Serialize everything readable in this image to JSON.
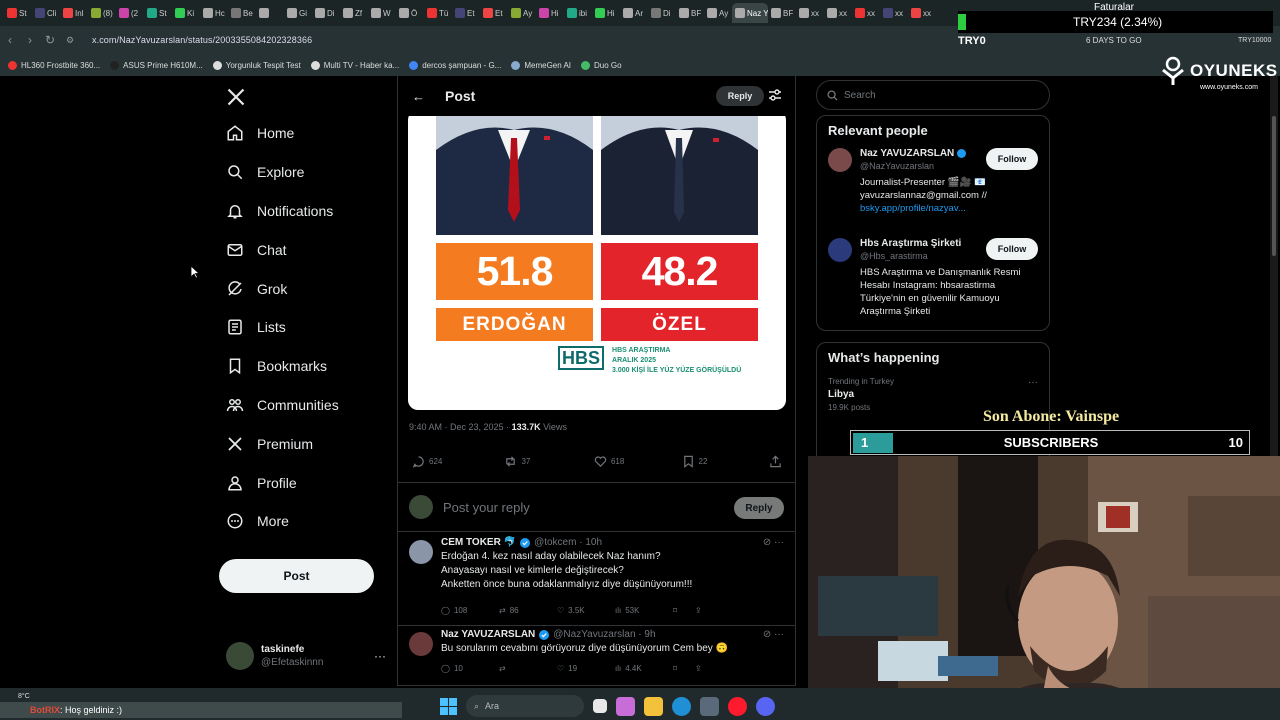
{
  "browser": {
    "tabs": [
      "St",
      "Cli",
      "Inl",
      "(8)",
      "(2",
      "St",
      "Ki",
      "Hc",
      "Be",
      "",
      "Gi",
      "Di",
      "Zf",
      "W",
      "Ö",
      "Tü",
      "Et",
      "Et",
      "Ay",
      "Hi",
      "ibi",
      "Hi",
      "Ar",
      "Di",
      "BF",
      "Ay",
      "Naz Y",
      "BF",
      "xx",
      "xx",
      "xx",
      "xx",
      "xx"
    ],
    "active_tab_index": 26,
    "url": "x.com/NazYavuzarslan/status/2003355084202328366",
    "bookmarks": [
      "HL360 Frostbite 360...",
      "ASUS Prime H610M...",
      "Yorgunluk Tespit Test",
      "Multi TV - Haber ka...",
      "dercos şampuan - G...",
      "MemeGen AI",
      "Duo Go"
    ],
    "ext_text": "6 DAYS TO GO",
    "ext_text2": "TRY10000"
  },
  "ticker": {
    "title": "Faturalar",
    "value": "TRY234 (2.34%)",
    "label": "TRY0"
  },
  "brand": {
    "name": "OYUNEKS",
    "site": "www.oyuneks.com"
  },
  "sidebar": {
    "items": [
      {
        "label": "Home",
        "icon": "home-icon"
      },
      {
        "label": "Explore",
        "icon": "search-icon"
      },
      {
        "label": "Notifications",
        "icon": "bell-icon"
      },
      {
        "label": "Chat",
        "icon": "mail-icon"
      },
      {
        "label": "Grok",
        "icon": "grok-icon"
      },
      {
        "label": "Lists",
        "icon": "list-icon"
      },
      {
        "label": "Bookmarks",
        "icon": "bookmark-icon"
      },
      {
        "label": "Communities",
        "icon": "communities-icon"
      },
      {
        "label": "Premium",
        "icon": "x-logo-icon"
      },
      {
        "label": "Profile",
        "icon": "person-icon"
      },
      {
        "label": "More",
        "icon": "more-circle-icon"
      }
    ],
    "post_label": "Post",
    "user": {
      "name": "taskinefe",
      "handle": "@Efetaskinnn"
    }
  },
  "post": {
    "header_title": "Post",
    "reply_label": "Reply",
    "image": {
      "left": {
        "pct": "51.8",
        "name": "ERDOĞAN",
        "color": "#f47b20"
      },
      "right": {
        "pct": "48.2",
        "name": "ÖZEL",
        "color": "#e3242b"
      },
      "logo": "HBS",
      "source_lines": [
        "HBS ARAŞTIRMA",
        "ARALIK 2025",
        "3.000 KİŞİ İLE YÜZ YÜZE GÖRÜŞÜLDÜ"
      ]
    },
    "time": "9:40 AM · Dec 23, 2025 · ",
    "views_count": "133.7K",
    "views_label": " Views",
    "stats": {
      "replies": "624",
      "reposts": "37",
      "likes": "618",
      "bookmarks": "22"
    },
    "composer_placeholder": "Post your reply",
    "composer_button": "Reply"
  },
  "replies": [
    {
      "name": "CEM TOKER 🐬",
      "handle": "@tokcem · 10h",
      "text": "Erdoğan 4. kez nasıl aday olabilecek Naz hanım?\nAnayasayı nasıl ve kimlerle değiştirecek?\nAnketten önce buna odaklanmalıyız diye düşünüyorum!!!",
      "replies": "108",
      "reposts": "86",
      "likes": "3.5K",
      "views": "53K"
    },
    {
      "name": "Naz YAVUZARSLAN",
      "handle": "@NazYavuzarslan · 9h",
      "text": "Bu sorularım cevabını görüyoruz diye düşünüyorum Cem bey 🙃",
      "replies": "10",
      "reposts": "",
      "likes": "19",
      "views": "4.4K"
    }
  ],
  "right": {
    "search_placeholder": "Search",
    "relevant_title": "Relevant people",
    "people": [
      {
        "name": "Naz YAVUZARSLAN",
        "handle": "@NazYavuzarslan",
        "bio": "Journalist-Presenter 🎬🎥 📧\nyavuzarslannaz@gmail.com //",
        "link": "bsky.app/profile/nazyav...",
        "follow": "Follow"
      },
      {
        "name": "Hbs Araştırma Şirketi",
        "handle": "@Hbs_arastirma",
        "bio": "HBS Araştırma ve Danışmanlık Resmi\nHesabı Instagram: hbsarastirma\nTürkiye'nin en güvenilir Kamuoyu\nAraştırma Şirketi",
        "link": "",
        "follow": "Follow"
      }
    ],
    "happening_title": "What’s happening",
    "trends": [
      {
        "kicker": "Trending in Turkey",
        "title": "Libya",
        "posts": "19.9K posts"
      }
    ]
  },
  "overlay": {
    "last_sub": "Son Abone: Vainspe",
    "sub_current": "1",
    "sub_label": "SUBSCRIBERS",
    "sub_goal": "10",
    "sub_progress": 0.1
  },
  "taskbar": {
    "temp": "8°C",
    "chat_user": "BotRIX",
    "chat_msg": ": Hoş geldiniz :)",
    "search": "Ara"
  }
}
